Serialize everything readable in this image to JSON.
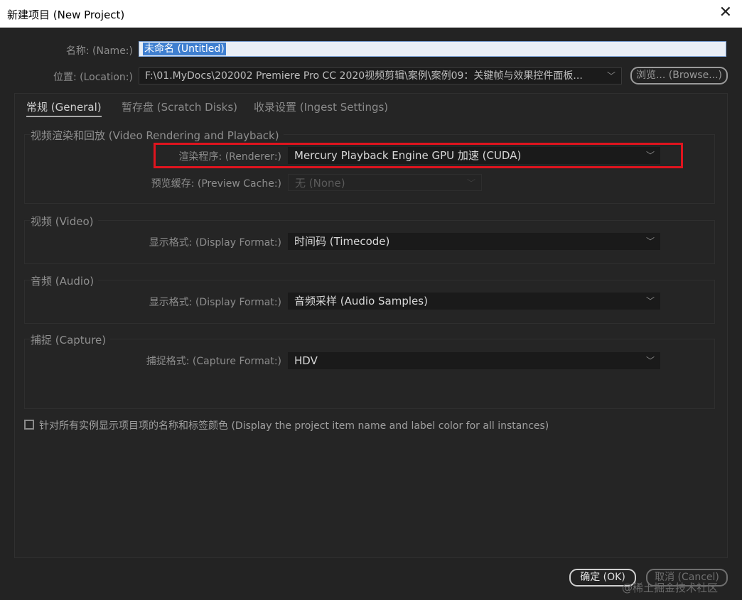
{
  "window": {
    "title": "新建项目 (New Project)"
  },
  "name_field": {
    "label": "名称: (Name:)",
    "value": "未命名 (Untitled)"
  },
  "location_field": {
    "label": "位置: (Location:)",
    "value": "F:\\01.MyDocs\\202002 Premiere Pro CC 2020视频剪辑\\案例\\案例09：关键帧与效果控件面板..."
  },
  "browse_button": {
    "label": "浏览... (Browse...)"
  },
  "tabs": [
    {
      "label": "常规 (General)",
      "active": true
    },
    {
      "label": "暂存盘 (Scratch Disks)",
      "active": false
    },
    {
      "label": "收录设置 (Ingest Settings)",
      "active": false
    }
  ],
  "video_rendering": {
    "title": "视频渲染和回放 (Video Rendering and Playback)",
    "renderer_label": "渲染程序: (Renderer:)",
    "renderer_value": "Mercury Playback Engine GPU 加速 (CUDA)",
    "preview_cache_label": "预览缓存: (Preview Cache:)",
    "preview_cache_value": "无 (None)"
  },
  "video": {
    "title": "视频 (Video)",
    "display_format_label": "显示格式: (Display Format:)",
    "display_format_value": "时间码 (Timecode)"
  },
  "audio": {
    "title": "音频 (Audio)",
    "display_format_label": "显示格式: (Display Format:)",
    "display_format_value": "音频采样 (Audio Samples)"
  },
  "capture": {
    "title": "捕捉 (Capture)",
    "capture_format_label": "捕捉格式: (Capture Format:)",
    "capture_format_value": "HDV"
  },
  "display_label_color": {
    "label": "针对所有实例显示项目项的名称和标签颜色 (Display the project item name and label color for all instances)",
    "checked": false
  },
  "buttons": {
    "ok": "确定 (OK)",
    "cancel": "取消 (Cancel)"
  },
  "watermark": "@稀土掘金技术社区",
  "colors": {
    "highlight": "#e0141e",
    "selection": "#3f7fd0",
    "background": "#232323"
  }
}
